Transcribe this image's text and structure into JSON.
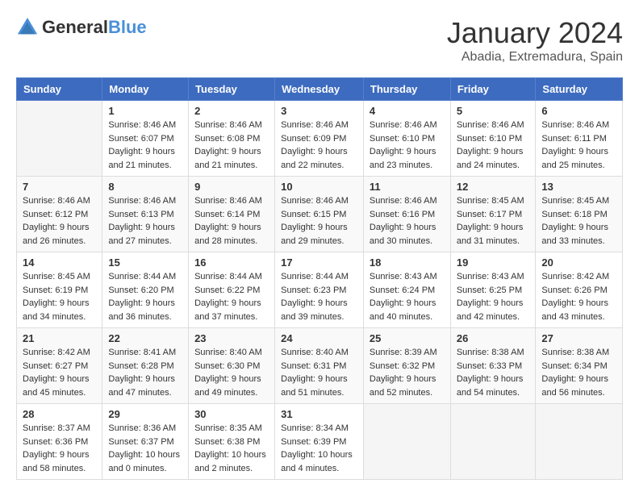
{
  "header": {
    "logo_general": "General",
    "logo_blue": "Blue",
    "month_year": "January 2024",
    "location": "Abadia, Extremadura, Spain"
  },
  "weekdays": [
    "Sunday",
    "Monday",
    "Tuesday",
    "Wednesday",
    "Thursday",
    "Friday",
    "Saturday"
  ],
  "weeks": [
    [
      {
        "day": "",
        "content": ""
      },
      {
        "day": "1",
        "content": "Sunrise: 8:46 AM\nSunset: 6:07 PM\nDaylight: 9 hours\nand 21 minutes."
      },
      {
        "day": "2",
        "content": "Sunrise: 8:46 AM\nSunset: 6:08 PM\nDaylight: 9 hours\nand 21 minutes."
      },
      {
        "day": "3",
        "content": "Sunrise: 8:46 AM\nSunset: 6:09 PM\nDaylight: 9 hours\nand 22 minutes."
      },
      {
        "day": "4",
        "content": "Sunrise: 8:46 AM\nSunset: 6:10 PM\nDaylight: 9 hours\nand 23 minutes."
      },
      {
        "day": "5",
        "content": "Sunrise: 8:46 AM\nSunset: 6:10 PM\nDaylight: 9 hours\nand 24 minutes."
      },
      {
        "day": "6",
        "content": "Sunrise: 8:46 AM\nSunset: 6:11 PM\nDaylight: 9 hours\nand 25 minutes."
      }
    ],
    [
      {
        "day": "7",
        "content": ""
      },
      {
        "day": "8",
        "content": "Sunrise: 8:46 AM\nSunset: 6:13 PM\nDaylight: 9 hours\nand 27 minutes."
      },
      {
        "day": "9",
        "content": "Sunrise: 8:46 AM\nSunset: 6:14 PM\nDaylight: 9 hours\nand 28 minutes."
      },
      {
        "day": "10",
        "content": "Sunrise: 8:46 AM\nSunset: 6:15 PM\nDaylight: 9 hours\nand 29 minutes."
      },
      {
        "day": "11",
        "content": "Sunrise: 8:46 AM\nSunset: 6:16 PM\nDaylight: 9 hours\nand 30 minutes."
      },
      {
        "day": "12",
        "content": "Sunrise: 8:45 AM\nSunset: 6:17 PM\nDaylight: 9 hours\nand 31 minutes."
      },
      {
        "day": "13",
        "content": "Sunrise: 8:45 AM\nSunset: 6:18 PM\nDaylight: 9 hours\nand 33 minutes."
      }
    ],
    [
      {
        "day": "14",
        "content": ""
      },
      {
        "day": "15",
        "content": "Sunrise: 8:44 AM\nSunset: 6:20 PM\nDaylight: 9 hours\nand 36 minutes."
      },
      {
        "day": "16",
        "content": "Sunrise: 8:44 AM\nSunset: 6:22 PM\nDaylight: 9 hours\nand 37 minutes."
      },
      {
        "day": "17",
        "content": "Sunrise: 8:44 AM\nSunset: 6:23 PM\nDaylight: 9 hours\nand 39 minutes."
      },
      {
        "day": "18",
        "content": "Sunrise: 8:43 AM\nSunset: 6:24 PM\nDaylight: 9 hours\nand 40 minutes."
      },
      {
        "day": "19",
        "content": "Sunrise: 8:43 AM\nSunset: 6:25 PM\nDaylight: 9 hours\nand 42 minutes."
      },
      {
        "day": "20",
        "content": "Sunrise: 8:42 AM\nSunset: 6:26 PM\nDaylight: 9 hours\nand 43 minutes."
      }
    ],
    [
      {
        "day": "21",
        "content": ""
      },
      {
        "day": "22",
        "content": "Sunrise: 8:41 AM\nSunset: 6:28 PM\nDaylight: 9 hours\nand 47 minutes."
      },
      {
        "day": "23",
        "content": "Sunrise: 8:40 AM\nSunset: 6:30 PM\nDaylight: 9 hours\nand 49 minutes."
      },
      {
        "day": "24",
        "content": "Sunrise: 8:40 AM\nSunset: 6:31 PM\nDaylight: 9 hours\nand 51 minutes."
      },
      {
        "day": "25",
        "content": "Sunrise: 8:39 AM\nSunset: 6:32 PM\nDaylight: 9 hours\nand 52 minutes."
      },
      {
        "day": "26",
        "content": "Sunrise: 8:38 AM\nSunset: 6:33 PM\nDaylight: 9 hours\nand 54 minutes."
      },
      {
        "day": "27",
        "content": "Sunrise: 8:38 AM\nSunset: 6:34 PM\nDaylight: 9 hours\nand 56 minutes."
      }
    ],
    [
      {
        "day": "28",
        "content": "Sunrise: 8:37 AM\nSunset: 6:36 PM\nDaylight: 9 hours\nand 58 minutes."
      },
      {
        "day": "29",
        "content": "Sunrise: 8:36 AM\nSunset: 6:37 PM\nDaylight: 10 hours\nand 0 minutes."
      },
      {
        "day": "30",
        "content": "Sunrise: 8:35 AM\nSunset: 6:38 PM\nDaylight: 10 hours\nand 2 minutes."
      },
      {
        "day": "31",
        "content": "Sunrise: 8:34 AM\nSunset: 6:39 PM\nDaylight: 10 hours\nand 4 minutes."
      },
      {
        "day": "",
        "content": ""
      },
      {
        "day": "",
        "content": ""
      },
      {
        "day": "",
        "content": ""
      }
    ]
  ],
  "week2_sunday": "Sunrise: 8:46 AM\nSunset: 6:12 PM\nDaylight: 9 hours\nand 26 minutes.",
  "week3_sunday": "Sunrise: 8:45 AM\nSunset: 6:19 PM\nDaylight: 9 hours\nand 34 minutes.",
  "week4_sunday": "Sunrise: 8:42 AM\nSunset: 6:27 PM\nDaylight: 9 hours\nand 45 minutes."
}
